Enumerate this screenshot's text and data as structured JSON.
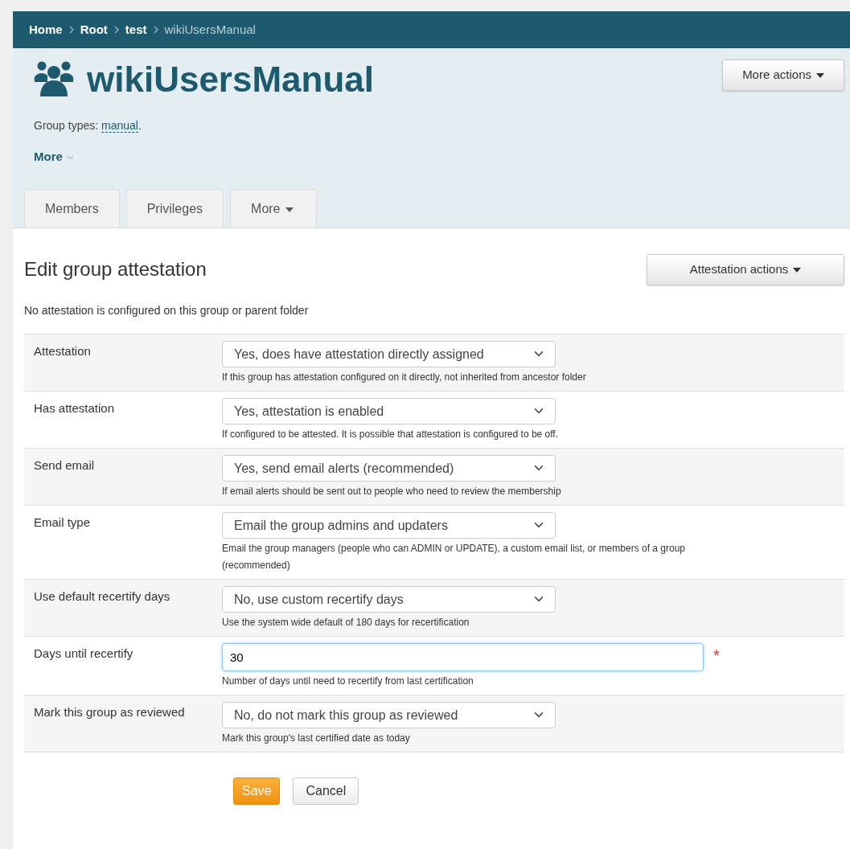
{
  "breadcrumb": [
    {
      "label": "Home",
      "current": false
    },
    {
      "label": "Root",
      "current": false
    },
    {
      "label": "test",
      "current": false
    },
    {
      "label": "wikiUsersManual",
      "current": true
    }
  ],
  "header": {
    "title": "wikiUsersManual",
    "more_actions": "More actions",
    "group_types_label": "Group types:",
    "group_type": "manual",
    "group_types_end": ".",
    "more_toggle": "More"
  },
  "tabs": [
    {
      "label": "Members",
      "selected": false,
      "dropdown": false
    },
    {
      "label": "Privileges",
      "selected": false,
      "dropdown": false
    },
    {
      "label": "More",
      "selected": false,
      "dropdown": true
    }
  ],
  "section": {
    "title": "Edit group attestation",
    "actions": "Attestation actions",
    "note": "No attestation is configured on this group or parent folder"
  },
  "rows": [
    {
      "label": "Attestation",
      "kind": "select",
      "value": "Yes, does have attestation directly assigned",
      "help": "If this group has attestation configured on it directly, not inherited from ancestor folder"
    },
    {
      "label": "Has attestation",
      "kind": "select",
      "value": "Yes, attestation is enabled",
      "help": "If configured to be attested. It is possible that attestation is configured to be off."
    },
    {
      "label": "Send email",
      "kind": "select",
      "value": "Yes, send email alerts (recommended)",
      "help": "If email alerts should be sent out to people who need to review the membership"
    },
    {
      "label": "Email type",
      "kind": "select",
      "value": "Email the group admins and updaters",
      "help": "Email the group managers (people who can ADMIN or UPDATE), a custom email list, or members of a group (recommended)"
    },
    {
      "label": "Use default recertify days",
      "kind": "select",
      "value": "No, use custom recertify days",
      "help": "Use the system wide default of 180 days for recertification"
    },
    {
      "label": "Days until recertify",
      "kind": "input",
      "value": "30",
      "help": "Number of days until need to recertify from last certification",
      "required_mark": "*"
    },
    {
      "label": "Mark this group as reviewed",
      "kind": "select",
      "value": "No, do not mark this group as reviewed",
      "help": "Mark this group's last certified date as today"
    }
  ],
  "buttons": {
    "save": "Save",
    "cancel": "Cancel"
  }
}
